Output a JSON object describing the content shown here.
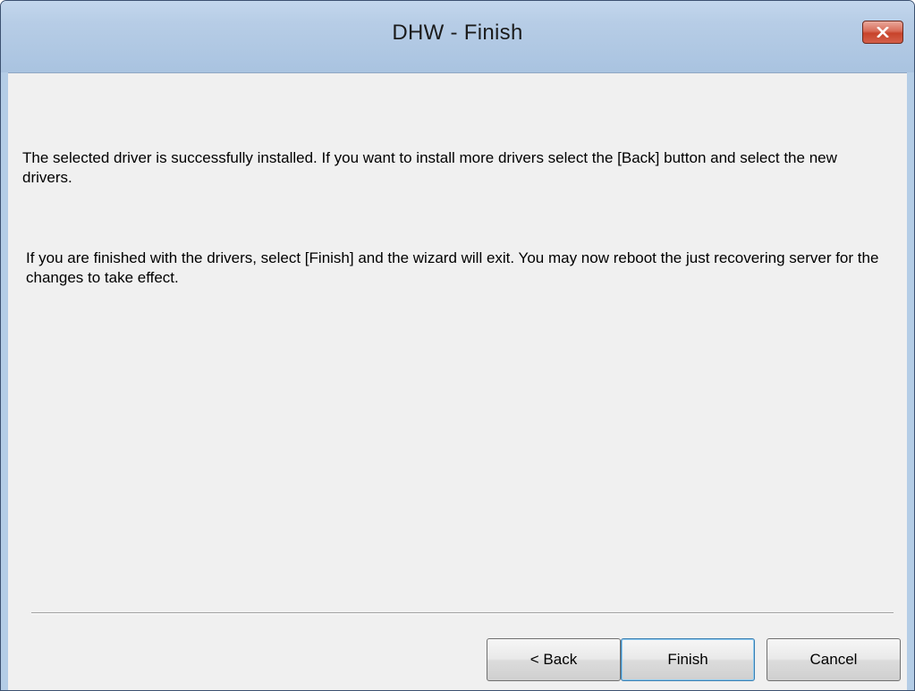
{
  "window": {
    "title": "DHW - Finish",
    "close_icon": "close-x-icon"
  },
  "content": {
    "paragraph1": "The selected driver is successfully installed. If you want to install more drivers select the [Back] button  and select the new drivers.",
    "paragraph2": "If you are finished with the drivers, select [Finish] and the wizard will exit. You may now reboot the just recovering server for the changes to take effect."
  },
  "buttons": {
    "back_label": "< Back",
    "finish_label": "Finish",
    "cancel_label": "Cancel"
  },
  "colors": {
    "titlebar": "#b4cde6",
    "client_background": "#f0f0f0",
    "close_button": "#c7432b",
    "default_button_border": "#3c7fb1"
  }
}
